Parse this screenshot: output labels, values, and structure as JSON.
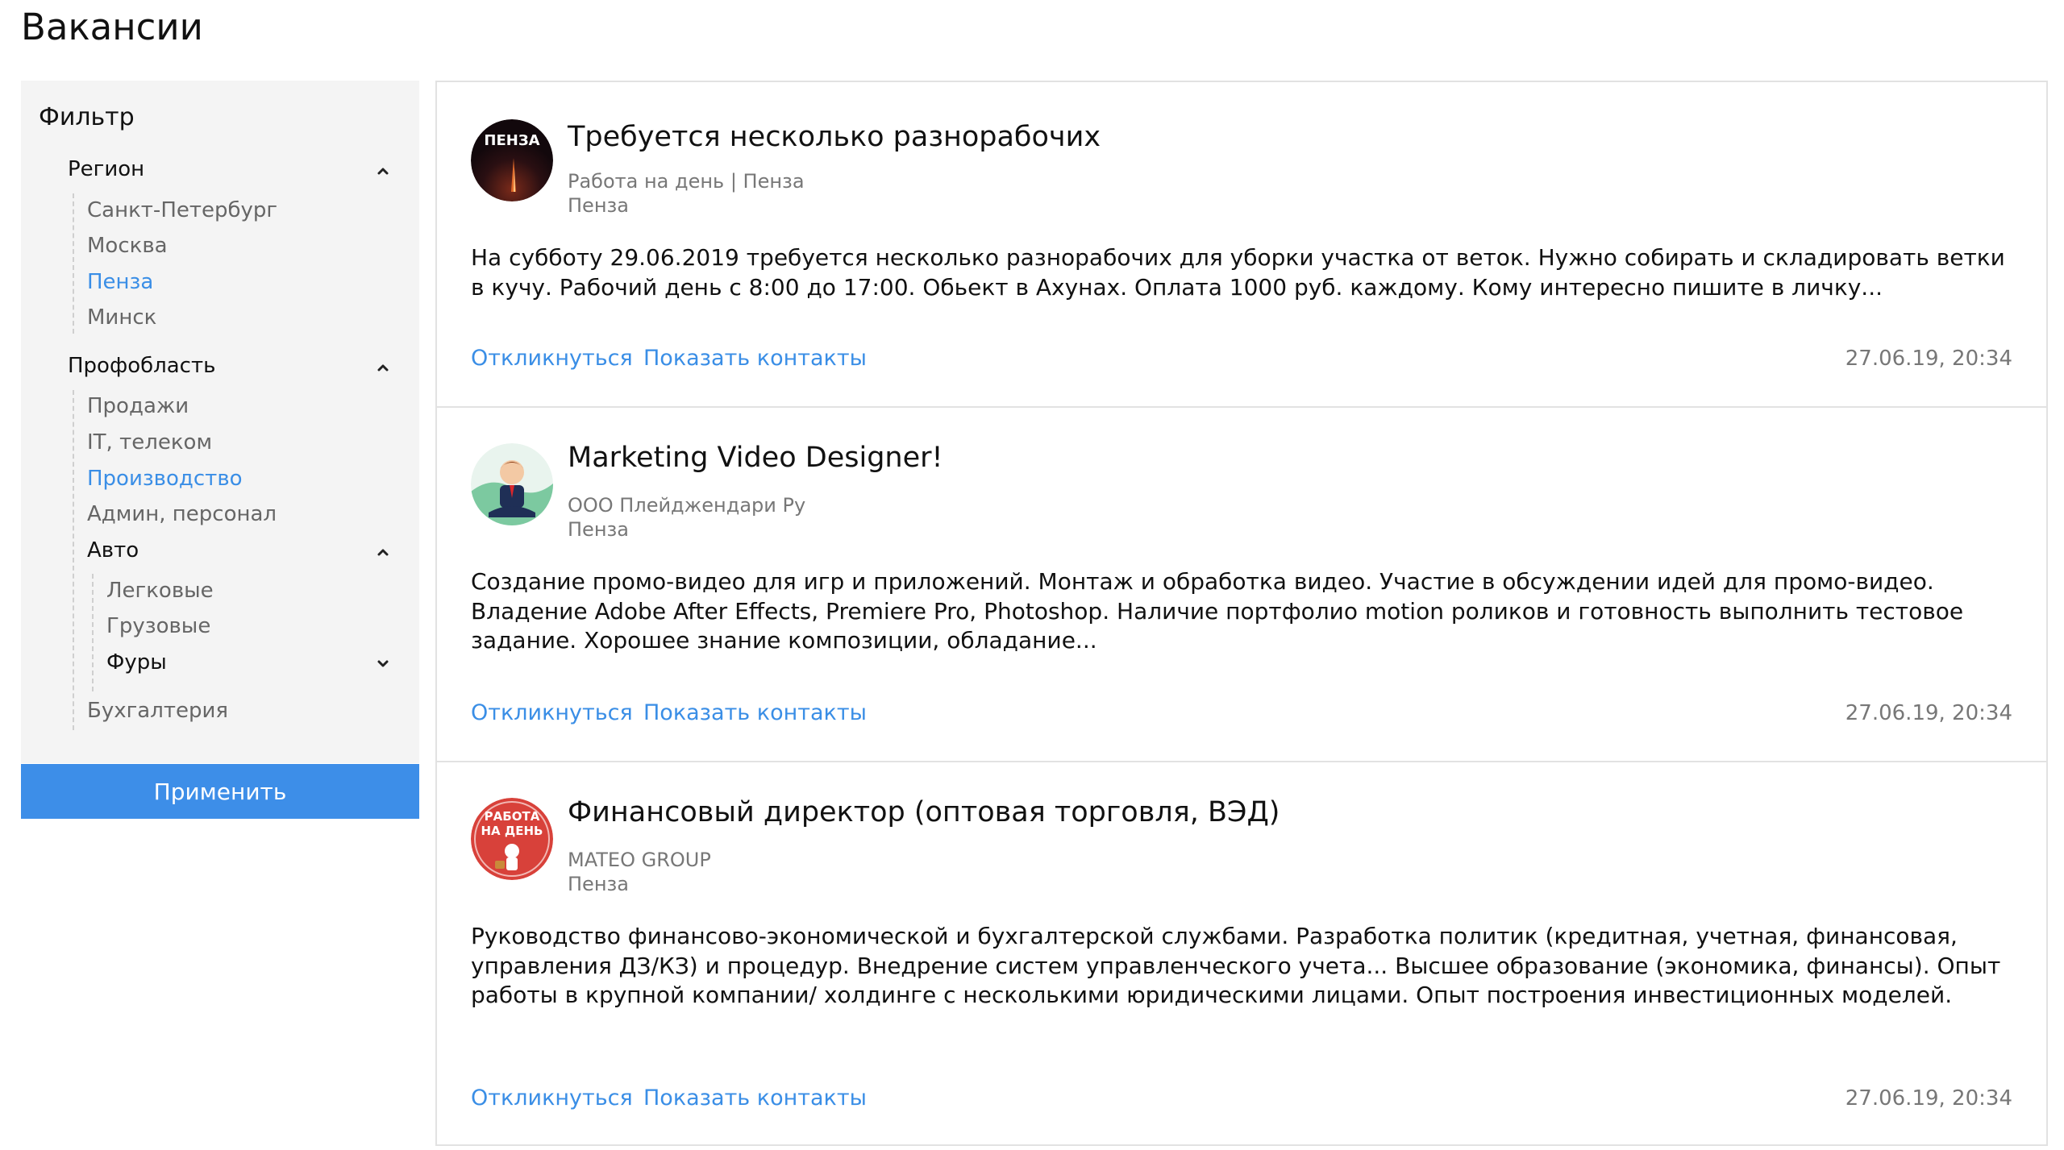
{
  "page": {
    "title": "Вакансии"
  },
  "filter": {
    "title": "Фильтр",
    "apply_label": "Применить",
    "region": {
      "label": "Регион",
      "items": [
        "Санкт-Петербург",
        "Москва",
        "Пенза",
        "Минск"
      ],
      "selected": "Пенза"
    },
    "profarea": {
      "label": "Профобласть",
      "items": [
        "Продажи",
        "IT, телеком",
        "Производство",
        "Админ, персонал"
      ],
      "selected": "Производство",
      "auto": {
        "label": "Авто",
        "items": [
          "Легковые",
          "Грузовые"
        ],
        "trucks_label": "Фуры"
      },
      "accounting": "Бухгалтерия"
    }
  },
  "vacancies": [
    {
      "title": "Требуется несколько разнорабочих",
      "company": "Работа на день | Пенза",
      "city": "Пенза",
      "avatar_text": "ПЕНЗА",
      "description": "На субботу 29.06.2019 требуется несколько разнорабочих для уборки участка от веток. Нужно собирать и складировать ветки в кучу. Рабочий день с 8:00 до 17:00. Обьект в Ахунах. Оплата 1000 руб. каждому. Кому интересно пишите в личку...",
      "respond_label": "Откликнуться",
      "contacts_label": "Показать контакты",
      "date": "27.06.19, 20:34"
    },
    {
      "title": "Marketing Video Designer!",
      "company": "ООО Плейджендари Ру",
      "city": "Пенза",
      "description": "Создание промо-видео для игр и приложений. Монтаж и обработка видео. Участие в обсуждении идей для промо-видео. Владение Adobe After Effects, Premiere Pro, Photoshop. Наличие портфолио motion роликов и готовность выполнить тестовое задание. Хорошее знание композиции, обладание...",
      "respond_label": "Откликнуться",
      "contacts_label": "Показать контакты",
      "date": "27.06.19, 20:34"
    },
    {
      "title": "Финансовый директор (оптовая торговля, ВЭД)",
      "company": "MATEO GROUP",
      "city": "Пенза",
      "avatar_text_1": "РАБОТА",
      "avatar_text_2": "НА ДЕНЬ",
      "description": "Руководство финансово-экономической и бухгалтерской службами. Разработка политик (кредитная, учетная, финансовая, управления ДЗ/КЗ) и процедур. Внедрение систем управленческого учета... Высшее образование (экономика, финансы). Опыт работы в крупной компании/ холдинге с несколькими юридическими лицами. Опыт построения инвестиционных моделей.",
      "respond_label": "Откликнуться",
      "contacts_label": "Показать контакты",
      "date": "27.06.19, 20:34"
    }
  ],
  "icons": {
    "collapse": "chevron-up-icon",
    "expand": "chevron-down-icon"
  },
  "colors": {
    "accent": "#3a8ee6",
    "button": "#3d8ee8",
    "sidebar_bg": "#f4f4f4"
  }
}
